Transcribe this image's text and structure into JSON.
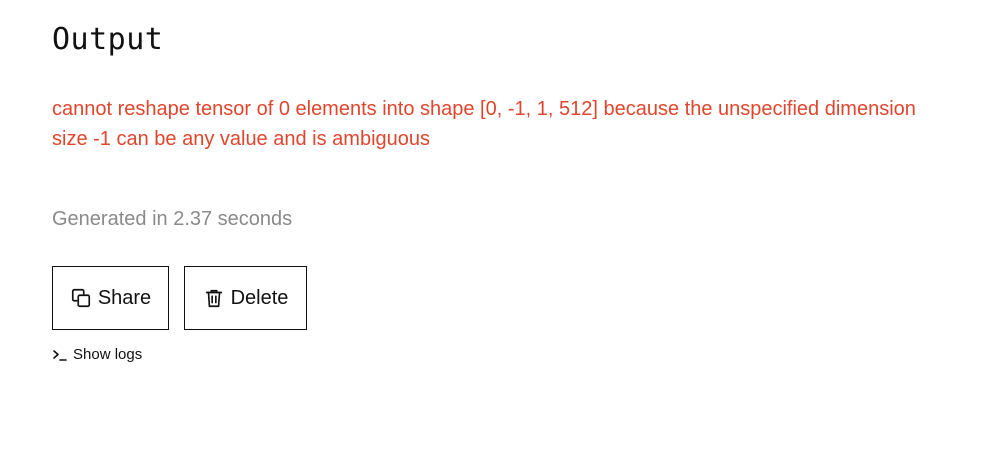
{
  "output": {
    "title": "Output",
    "error_message": "cannot reshape tensor of 0 elements into shape [0, -1, 1, 512] because the unspecified dimension size -1 can be any value and is ambiguous",
    "generated_text": "Generated in 2.37 seconds"
  },
  "actions": {
    "share_label": "Share",
    "share_icon": "copy-icon",
    "delete_label": "Delete",
    "delete_icon": "trash-icon"
  },
  "logs": {
    "label": "Show logs",
    "icon": "terminal-icon"
  },
  "colors": {
    "error": "#e0462d",
    "muted": "#8a8a8a",
    "text": "#111111",
    "background": "#ffffff"
  }
}
